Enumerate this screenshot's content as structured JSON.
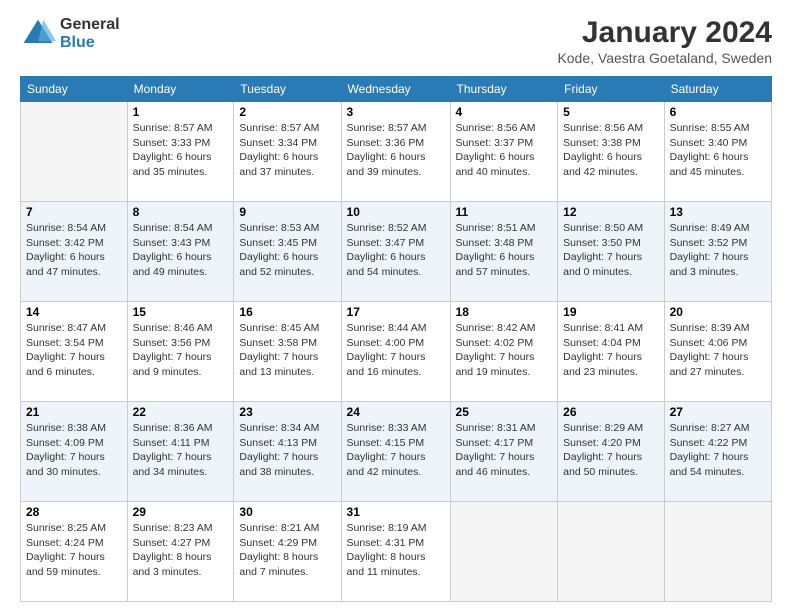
{
  "logo": {
    "general": "General",
    "blue": "Blue"
  },
  "header": {
    "title": "January 2024",
    "subtitle": "Kode, Vaestra Goetaland, Sweden"
  },
  "days_of_week": [
    "Sunday",
    "Monday",
    "Tuesday",
    "Wednesday",
    "Thursday",
    "Friday",
    "Saturday"
  ],
  "weeks": [
    [
      {
        "num": "",
        "empty": true
      },
      {
        "num": "1",
        "sunrise": "Sunrise: 8:57 AM",
        "sunset": "Sunset: 3:33 PM",
        "daylight": "Daylight: 6 hours and 35 minutes."
      },
      {
        "num": "2",
        "sunrise": "Sunrise: 8:57 AM",
        "sunset": "Sunset: 3:34 PM",
        "daylight": "Daylight: 6 hours and 37 minutes."
      },
      {
        "num": "3",
        "sunrise": "Sunrise: 8:57 AM",
        "sunset": "Sunset: 3:36 PM",
        "daylight": "Daylight: 6 hours and 39 minutes."
      },
      {
        "num": "4",
        "sunrise": "Sunrise: 8:56 AM",
        "sunset": "Sunset: 3:37 PM",
        "daylight": "Daylight: 6 hours and 40 minutes."
      },
      {
        "num": "5",
        "sunrise": "Sunrise: 8:56 AM",
        "sunset": "Sunset: 3:38 PM",
        "daylight": "Daylight: 6 hours and 42 minutes."
      },
      {
        "num": "6",
        "sunrise": "Sunrise: 8:55 AM",
        "sunset": "Sunset: 3:40 PM",
        "daylight": "Daylight: 6 hours and 45 minutes."
      }
    ],
    [
      {
        "num": "7",
        "sunrise": "Sunrise: 8:54 AM",
        "sunset": "Sunset: 3:42 PM",
        "daylight": "Daylight: 6 hours and 47 minutes."
      },
      {
        "num": "8",
        "sunrise": "Sunrise: 8:54 AM",
        "sunset": "Sunset: 3:43 PM",
        "daylight": "Daylight: 6 hours and 49 minutes."
      },
      {
        "num": "9",
        "sunrise": "Sunrise: 8:53 AM",
        "sunset": "Sunset: 3:45 PM",
        "daylight": "Daylight: 6 hours and 52 minutes."
      },
      {
        "num": "10",
        "sunrise": "Sunrise: 8:52 AM",
        "sunset": "Sunset: 3:47 PM",
        "daylight": "Daylight: 6 hours and 54 minutes."
      },
      {
        "num": "11",
        "sunrise": "Sunrise: 8:51 AM",
        "sunset": "Sunset: 3:48 PM",
        "daylight": "Daylight: 6 hours and 57 minutes."
      },
      {
        "num": "12",
        "sunrise": "Sunrise: 8:50 AM",
        "sunset": "Sunset: 3:50 PM",
        "daylight": "Daylight: 7 hours and 0 minutes."
      },
      {
        "num": "13",
        "sunrise": "Sunrise: 8:49 AM",
        "sunset": "Sunset: 3:52 PM",
        "daylight": "Daylight: 7 hours and 3 minutes."
      }
    ],
    [
      {
        "num": "14",
        "sunrise": "Sunrise: 8:47 AM",
        "sunset": "Sunset: 3:54 PM",
        "daylight": "Daylight: 7 hours and 6 minutes."
      },
      {
        "num": "15",
        "sunrise": "Sunrise: 8:46 AM",
        "sunset": "Sunset: 3:56 PM",
        "daylight": "Daylight: 7 hours and 9 minutes."
      },
      {
        "num": "16",
        "sunrise": "Sunrise: 8:45 AM",
        "sunset": "Sunset: 3:58 PM",
        "daylight": "Daylight: 7 hours and 13 minutes."
      },
      {
        "num": "17",
        "sunrise": "Sunrise: 8:44 AM",
        "sunset": "Sunset: 4:00 PM",
        "daylight": "Daylight: 7 hours and 16 minutes."
      },
      {
        "num": "18",
        "sunrise": "Sunrise: 8:42 AM",
        "sunset": "Sunset: 4:02 PM",
        "daylight": "Daylight: 7 hours and 19 minutes."
      },
      {
        "num": "19",
        "sunrise": "Sunrise: 8:41 AM",
        "sunset": "Sunset: 4:04 PM",
        "daylight": "Daylight: 7 hours and 23 minutes."
      },
      {
        "num": "20",
        "sunrise": "Sunrise: 8:39 AM",
        "sunset": "Sunset: 4:06 PM",
        "daylight": "Daylight: 7 hours and 27 minutes."
      }
    ],
    [
      {
        "num": "21",
        "sunrise": "Sunrise: 8:38 AM",
        "sunset": "Sunset: 4:09 PM",
        "daylight": "Daylight: 7 hours and 30 minutes."
      },
      {
        "num": "22",
        "sunrise": "Sunrise: 8:36 AM",
        "sunset": "Sunset: 4:11 PM",
        "daylight": "Daylight: 7 hours and 34 minutes."
      },
      {
        "num": "23",
        "sunrise": "Sunrise: 8:34 AM",
        "sunset": "Sunset: 4:13 PM",
        "daylight": "Daylight: 7 hours and 38 minutes."
      },
      {
        "num": "24",
        "sunrise": "Sunrise: 8:33 AM",
        "sunset": "Sunset: 4:15 PM",
        "daylight": "Daylight: 7 hours and 42 minutes."
      },
      {
        "num": "25",
        "sunrise": "Sunrise: 8:31 AM",
        "sunset": "Sunset: 4:17 PM",
        "daylight": "Daylight: 7 hours and 46 minutes."
      },
      {
        "num": "26",
        "sunrise": "Sunrise: 8:29 AM",
        "sunset": "Sunset: 4:20 PM",
        "daylight": "Daylight: 7 hours and 50 minutes."
      },
      {
        "num": "27",
        "sunrise": "Sunrise: 8:27 AM",
        "sunset": "Sunset: 4:22 PM",
        "daylight": "Daylight: 7 hours and 54 minutes."
      }
    ],
    [
      {
        "num": "28",
        "sunrise": "Sunrise: 8:25 AM",
        "sunset": "Sunset: 4:24 PM",
        "daylight": "Daylight: 7 hours and 59 minutes."
      },
      {
        "num": "29",
        "sunrise": "Sunrise: 8:23 AM",
        "sunset": "Sunset: 4:27 PM",
        "daylight": "Daylight: 8 hours and 3 minutes."
      },
      {
        "num": "30",
        "sunrise": "Sunrise: 8:21 AM",
        "sunset": "Sunset: 4:29 PM",
        "daylight": "Daylight: 8 hours and 7 minutes."
      },
      {
        "num": "31",
        "sunrise": "Sunrise: 8:19 AM",
        "sunset": "Sunset: 4:31 PM",
        "daylight": "Daylight: 8 hours and 11 minutes."
      },
      {
        "num": "",
        "empty": true
      },
      {
        "num": "",
        "empty": true
      },
      {
        "num": "",
        "empty": true
      }
    ]
  ]
}
